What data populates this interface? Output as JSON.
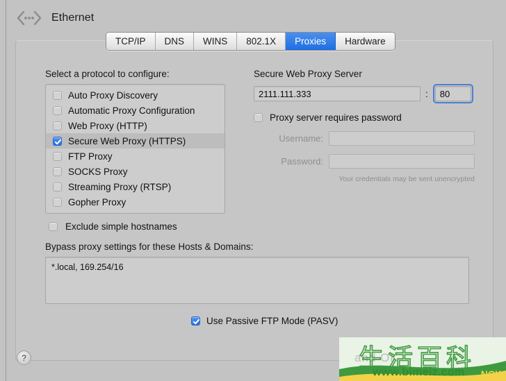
{
  "window": {
    "title": "Ethernet",
    "icon": "ethernet-icon"
  },
  "tabs": [
    {
      "label": "TCP/IP",
      "active": false
    },
    {
      "label": "DNS",
      "active": false
    },
    {
      "label": "WINS",
      "active": false
    },
    {
      "label": "802.1X",
      "active": false
    },
    {
      "label": "Proxies",
      "active": true
    },
    {
      "label": "Hardware",
      "active": false
    }
  ],
  "left": {
    "section_label": "Select a protocol to configure:",
    "protocols": [
      {
        "label": "Auto Proxy Discovery",
        "checked": false,
        "selected": false
      },
      {
        "label": "Automatic Proxy Configuration",
        "checked": false,
        "selected": false
      },
      {
        "label": "Web Proxy (HTTP)",
        "checked": false,
        "selected": false
      },
      {
        "label": "Secure Web Proxy (HTTPS)",
        "checked": true,
        "selected": true
      },
      {
        "label": "FTP Proxy",
        "checked": false,
        "selected": false
      },
      {
        "label": "SOCKS Proxy",
        "checked": false,
        "selected": false
      },
      {
        "label": "Streaming Proxy (RTSP)",
        "checked": false,
        "selected": false
      },
      {
        "label": "Gopher Proxy",
        "checked": false,
        "selected": false
      }
    ],
    "exclude_simple_hostnames": {
      "label": "Exclude simple hostnames",
      "checked": false
    },
    "bypass": {
      "label": "Bypass proxy settings for these Hosts & Domains:",
      "value": "*.local, 169.254/16"
    }
  },
  "right": {
    "server_heading": "Secure Web Proxy Server",
    "server_value": "2111.111.333",
    "colon": ":",
    "port_value": "80",
    "requires_password": {
      "label": "Proxy server requires password",
      "checked": false
    },
    "username_label": "Username:",
    "username_value": "",
    "password_label": "Password:",
    "password_value": "",
    "credentials_note": "Your credentials may be sent unencrypted"
  },
  "footer": {
    "passive_ftp": {
      "label": "Use Passive FTP Mode (PASV)",
      "checked": true
    },
    "help_label": "?"
  },
  "watermark": {
    "cjk": "生活百科",
    "faint": "and          OK",
    "url": "www.bimeiz.com",
    "now": "NOW",
    "accent_green": "#2e8b2e",
    "accent_yellow": "#f3d24a"
  },
  "colors": {
    "accent_blue": "#2470e4",
    "window_bg": "#c3c3c3",
    "field_bg": "#cdcdcd"
  }
}
